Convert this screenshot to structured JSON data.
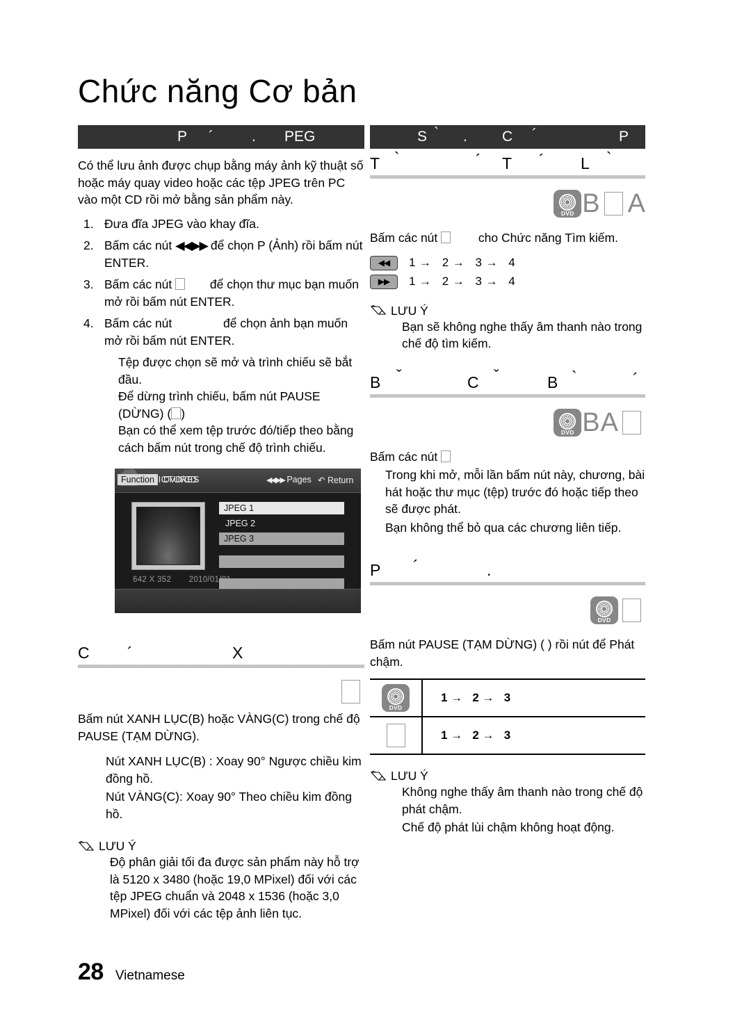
{
  "page": {
    "title": "Chức năng Cơ bản",
    "number": "28",
    "language": "Vietnamese"
  },
  "left_column": {
    "chapter_bar": {
      "fragments": [
        "P",
        "´",
        ".",
        "PEG"
      ]
    },
    "intro": "Có thể lưu ảnh được chụp bằng máy ảnh kỹ thuật số hoặc máy quay video hoặc các tệp JPEG trên PC vào một CD rồi mở bằng sản phẩm này.",
    "steps": [
      {
        "num": "1.",
        "text": "Đưa đĩa JPEG vào khay đĩa."
      },
      {
        "num": "2.",
        "text_before": "Bấm các nút",
        "icon": "rewind-forward-buttons",
        "text_after": "để chọn P          (Ảnh) rồi bấm nút ENTER."
      },
      {
        "num": "3.",
        "text_before": "Bấm các nút",
        "icon": "box-glyph",
        "text_after": "để chọn thư mục bạn muốn mở rồi bấm nút ENTER."
      },
      {
        "num": "4.",
        "text_before": "Bấm các nút",
        "text_after": "để chọn ảnh bạn muốn mở rồi bấm nút ENTER."
      }
    ],
    "step_notes": [
      "Tệp được chọn sẽ mở và trình chiếu sẽ bắt đầu.",
      "Để dừng trình chiếu, bấm nút PAUSE (DỪNG) (",
      ")",
      "Bạn có thể xem tệp trước đó/tiếp theo bằng cách bấm nút              trong chế độ trình chiếu."
    ],
    "osd": {
      "path": "../ PICTURES",
      "items": [
        "JPEG 1",
        "JPEG 2",
        "JPEG 3",
        "",
        ""
      ],
      "resolution": "642 X 352",
      "date": "2010/01/01",
      "function_label": "Function",
      "source_label": "DVD/CD",
      "pages_label": "Pages",
      "return_label": "Return"
    },
    "rotate_section": {
      "header_fragments": [
        "C",
        "´",
        "X"
      ],
      "instruction": "Bấm nút XANH LỤC(B)  hoặc VÀNG(C) trong chế độ PAUSE (TẠM DỪNG).",
      "bullets": [
        "Nút XANH LỤC(B) : Xoay 90° Ngược chiều kim đồng hồ.",
        "Nút VÀNG(C): Xoay 90° Theo chiều kim đồng hồ."
      ]
    },
    "note": {
      "label": "LƯU Ý",
      "body": "Độ phân giải tối đa được sản phẩm này hỗ trợ là 5120 x 3480 (hoặc 19,0 MPixel) đối với các tệp JPEG chuẩn và 2048 x 1536 (hoặc 3,0 MPixel) đối với các tệp ảnh liên tục."
    }
  },
  "right_column": {
    "chapter_bar": {
      "fragments": [
        "S",
        "`",
        ".",
        "C",
        "´",
        "P"
      ]
    },
    "search_section": {
      "header_fragments": [
        "T",
        "`",
        "´",
        "T",
        "´",
        "L",
        "`"
      ],
      "badges": [
        "dvd-icon",
        "B",
        "box-glyph",
        "A"
      ],
      "instruction_before": "Bấm các nút",
      "instruction_after": "cho Chức năng Tìm kiếm.",
      "sequences": [
        {
          "key": "rewind-button",
          "steps": "1 →   2 →   3 →   4"
        },
        {
          "key": "forward-button",
          "steps": "1 →   2 →   3 →   4"
        }
      ],
      "note": {
        "label": "LƯU Ý",
        "body": "Bạn sẽ không nghe thấy âm thanh nào trong chế độ tìm kiếm."
      }
    },
    "skip_section": {
      "header_fragments": [
        "B",
        "ˇ",
        "C",
        "ˇ",
        "B",
        "`",
        "´"
      ],
      "badges": [
        "dvd-icon",
        "B",
        "A",
        "box-glyph"
      ],
      "instruction_before": "Bấm các nút",
      "body": [
        "Trong khi mở, mỗi lần bấm nút này, chương, bài hát hoặc thư mục (tệp) trước đó hoặc tiếp theo sẽ được phát.",
        "Bạn không thể bỏ qua các chương liên tiếp."
      ]
    },
    "slow_section": {
      "header_fragments": [
        "P",
        "´",
        "."
      ],
      "badges": [
        "dvd-icon",
        "box-glyph"
      ],
      "instruction": "Bấm nút PAUSE (TẠM DỪNG) (   ) rồi nút        để Phát chậm.",
      "table": [
        {
          "icon": "dvd-icon",
          "steps": "1 →   2 →   3"
        },
        {
          "icon": "box-glyph",
          "steps": "1 →   2 →   3"
        }
      ],
      "note": {
        "label": "LƯU Ý",
        "body": [
          "Không nghe thấy âm thanh nào trong chế độ phát chậm.",
          "Chế độ phát lùi chậm không hoạt động."
        ]
      }
    }
  },
  "colors": {
    "bar_background": "#333333",
    "rule": "#c5c5c5",
    "badge_gray": "#868686",
    "key_gray": "#a6a6a6"
  }
}
